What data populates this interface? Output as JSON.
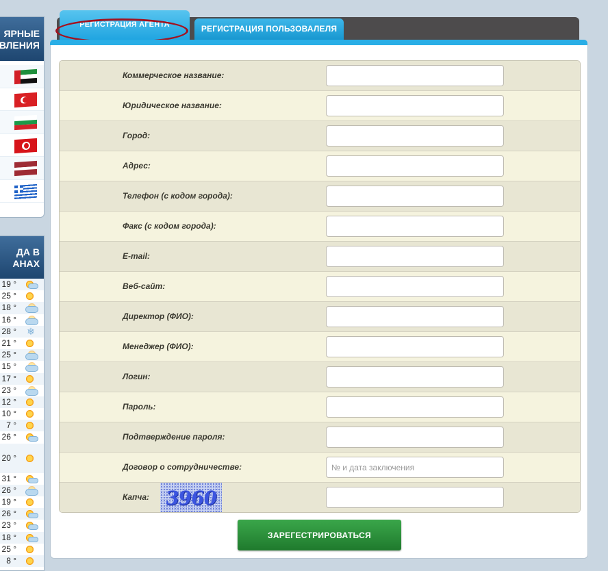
{
  "sidebar": {
    "directions_title": "ЯРНЫЕ\nВЛЕНИЯ",
    "flags": [
      {
        "country": "uae"
      },
      {
        "country": "turkey"
      },
      {
        "country": "bulgaria"
      },
      {
        "country": "tunisia"
      },
      {
        "country": "latvia"
      },
      {
        "country": "greece"
      }
    ],
    "weather_title": "ДА В\nАНАХ",
    "weather": [
      {
        "temp": "19 °",
        "icon": "sun-cloud-icon"
      },
      {
        "temp": "25 °",
        "icon": "sun-icon"
      },
      {
        "temp": "18 °",
        "icon": "cloud-icon"
      },
      {
        "temp": "16 °",
        "icon": "cloud-icon"
      },
      {
        "temp": "28 °",
        "icon": "snow-icon"
      },
      {
        "temp": "21 °",
        "icon": "sun-icon"
      },
      {
        "temp": "25 °",
        "icon": "cloud-icon"
      },
      {
        "temp": "15 °",
        "icon": "cloud-icon"
      },
      {
        "temp": "17 °",
        "icon": "sun-icon"
      },
      {
        "temp": "23 °",
        "icon": "cloud-icon"
      },
      {
        "temp": "12 °",
        "icon": "sun-icon"
      },
      {
        "temp": "10 °",
        "icon": "sun-icon"
      },
      {
        "temp": "7 °",
        "icon": "sun-icon"
      },
      {
        "temp": "26 °",
        "icon": "sun-cloud-icon"
      },
      {
        "temp": "20 °",
        "icon": "sun-icon"
      },
      {
        "temp": "31 °",
        "icon": "sun-cloud-icon"
      },
      {
        "temp": "26 °",
        "icon": "cloud-icon"
      },
      {
        "temp": "19 °",
        "icon": "sun-icon"
      },
      {
        "temp": "26 °",
        "icon": "sun-cloud-icon"
      },
      {
        "temp": "23 °",
        "icon": "sun-cloud-icon"
      },
      {
        "temp": "18 °",
        "icon": "sun-cloud-icon"
      },
      {
        "temp": "25 °",
        "icon": "sun-icon"
      },
      {
        "temp": "8 °",
        "icon": "sun-icon"
      }
    ]
  },
  "tabs": {
    "agent": "РЕГИСТРАЦИЯ АГЕНТА",
    "user": "РЕГИСТРАЦИЯ ПОЛЬЗОВАЛЕЛЯ"
  },
  "form": {
    "fields": [
      {
        "label": "Коммерческое название:",
        "value": "",
        "placeholder": ""
      },
      {
        "label": "Юридическое название:",
        "value": "",
        "placeholder": ""
      },
      {
        "label": "Город:",
        "value": "",
        "placeholder": ""
      },
      {
        "label": "Адрес:",
        "value": "",
        "placeholder": ""
      },
      {
        "label": "Телефон (с кодом города):",
        "value": "",
        "placeholder": ""
      },
      {
        "label": "Факс (с кодом города):",
        "value": "",
        "placeholder": ""
      },
      {
        "label": "E-mail:",
        "value": "",
        "placeholder": ""
      },
      {
        "label": "Веб-сайт:",
        "value": "",
        "placeholder": ""
      },
      {
        "label": "Директор (ФИО):",
        "value": "",
        "placeholder": ""
      },
      {
        "label": "Менеджер (ФИО):",
        "value": "",
        "placeholder": ""
      },
      {
        "label": "Логин:",
        "value": "",
        "placeholder": ""
      },
      {
        "label": "Пароль:",
        "value": "",
        "placeholder": ""
      },
      {
        "label": "Подтверждение пароля:",
        "value": "",
        "placeholder": ""
      },
      {
        "label": "Договор о сотрудничестве:",
        "value": "",
        "placeholder": "№ и дата заключения"
      }
    ],
    "captcha": {
      "label": "Капча:",
      "image_text": "3960",
      "value": ""
    },
    "submit_label": "ЗАРЕГЕСТРИРОВАТЬСЯ"
  },
  "colors": {
    "tab_active": "#29aee6",
    "tab_bar": "#4d4b4c",
    "row_odd": "#e8e6d3",
    "row_even": "#f5f3de",
    "submit": "#2a8d3a",
    "highlight": "#a3121f"
  }
}
